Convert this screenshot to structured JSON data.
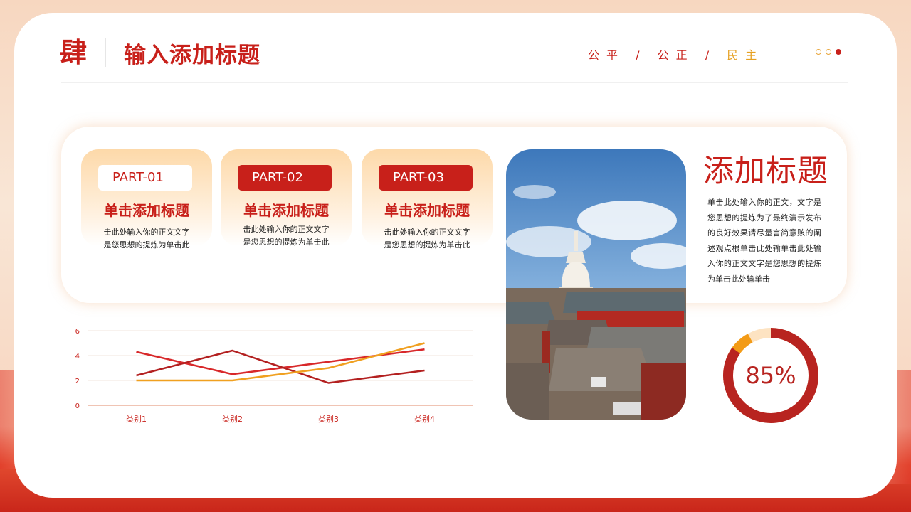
{
  "header": {
    "logo_char": "肆",
    "title": "输入添加标题",
    "motto": {
      "w1": "公平",
      "sep1": "/",
      "w2": "公正",
      "sep2": "/",
      "w3": "民主"
    }
  },
  "parts": [
    {
      "tag": "PART-01",
      "title": "单击添加标题",
      "line1": "击此处输入你的正文文字",
      "line2": "是您思想的提炼为单击此"
    },
    {
      "tag": "PART-02",
      "title": "单击添加标题",
      "line1": "击此处输入你的正文文字",
      "line2": "是您思想的提炼为单击此"
    },
    {
      "tag": "PART-03",
      "title": "单击添加标题",
      "line1": "击此处输入你的正文文字",
      "line2": "是您思想的提炼为单击此"
    }
  ],
  "side": {
    "title": "添加标题",
    "text": "单击此处输入你的正文，文字是您思想的提炼为了最终演示发布的良好效果请尽量言简意赅的阐述观点根单击此处输单击此处输入你的正文文字是您思想的提炼为单击此处输单击"
  },
  "chart_data": {
    "type": "line",
    "categories": [
      "类别1",
      "类别2",
      "类别3",
      "类别4"
    ],
    "ylim": [
      0,
      6
    ],
    "yticks": [
      0,
      2,
      4,
      6
    ],
    "series": [
      {
        "values": [
          4.3,
          2.5,
          3.5,
          4.5
        ],
        "color": "#d8282a"
      },
      {
        "values": [
          2.4,
          4.4,
          1.8,
          2.8
        ],
        "color": "#b32020"
      },
      {
        "values": [
          2.0,
          2.0,
          3.0,
          5.0
        ],
        "color": "#f0a020"
      }
    ]
  },
  "donut": {
    "percent": 85,
    "label": "85%",
    "colors": {
      "main": "#b82420",
      "accent": "#f39b16",
      "track": "#fde3c2"
    }
  }
}
